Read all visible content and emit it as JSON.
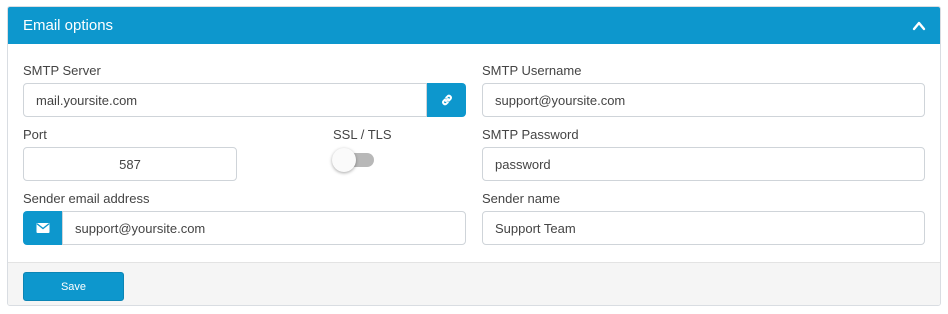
{
  "panel": {
    "title": "Email options",
    "collapse_icon": "chevron-up-icon"
  },
  "smtp_server": {
    "label": "SMTP Server",
    "value": "mail.yoursite.com",
    "button_icon": "link-icon"
  },
  "smtp_username": {
    "label": "SMTP Username",
    "value": "support@yoursite.com"
  },
  "port": {
    "label": "Port",
    "value": "587"
  },
  "ssl_tls": {
    "label": "SSL / TLS",
    "enabled": false
  },
  "smtp_password": {
    "label": "SMTP Password",
    "value": "password"
  },
  "sender_email": {
    "label": "Sender email address",
    "value": "support@yoursite.com",
    "icon": "envelope-icon"
  },
  "sender_name": {
    "label": "Sender name",
    "value": "Support Team"
  },
  "footer": {
    "save_label": "Save"
  },
  "colors": {
    "accent": "#0d97cd",
    "toggle_off": "#b8b8b8"
  }
}
